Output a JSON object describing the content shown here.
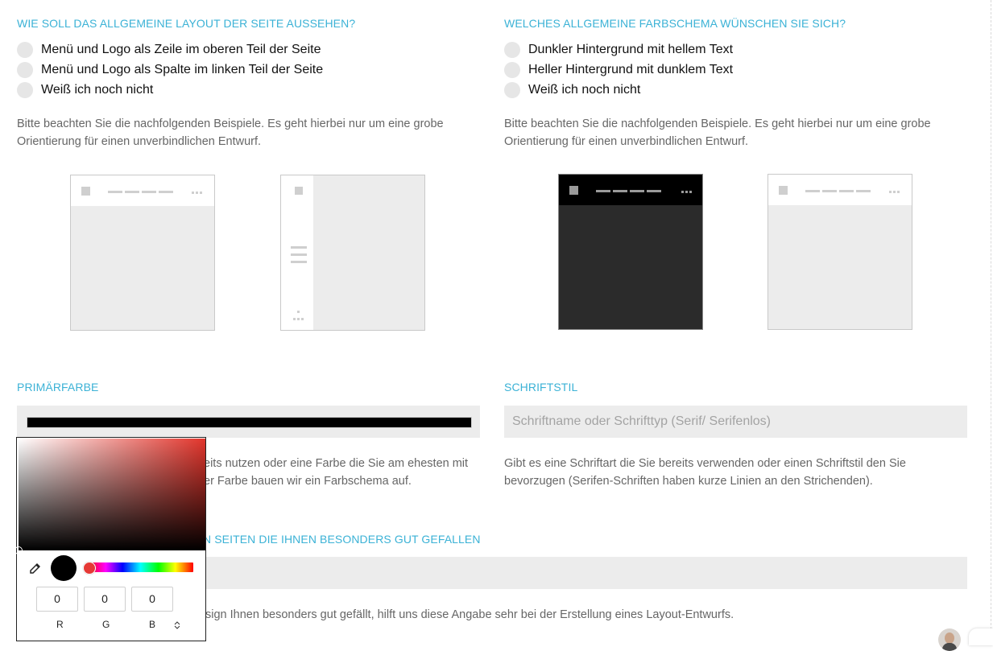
{
  "layout_question": {
    "title": "WIE SOLL DAS ALLGEMEINE LAYOUT DER SEITE AUSSEHEN?",
    "options": [
      "Menü und Logo als Zeile im oberen Teil der Seite",
      "Menü und Logo als Spalte im linken Teil der Seite",
      "Weiß ich noch nicht"
    ],
    "hint_line1": "Bitte beachten Sie die nachfolgenden Beispiele. Es geht hierbei nur um eine grobe",
    "hint_line2": "Orientierung für einen unverbindlichen Entwurf."
  },
  "color_question": {
    "title": "WELCHES ALLGEMEINE FARBSCHEMA WÜNSCHEN SIE SICH?",
    "options": [
      "Dunkler Hintergrund mit hellem Text",
      "Heller Hintergrund mit dunklem Text",
      "Weiß ich noch nicht"
    ],
    "hint_line1": "Bitte beachten Sie die nachfolgenden Beispiele. Es geht hierbei nur um eine grobe",
    "hint_line2": "Orientierung für einen unverbindlichen Entwurf."
  },
  "primary_color": {
    "title": "PRIMÄRFARBE",
    "value_color": "#000000",
    "hint_line1": "eits nutzen oder eine Farbe die Sie am ehesten mit",
    "hint_line2": "er Farbe bauen wir ein Farbschema auf."
  },
  "font_style": {
    "title": "SCHRIFTSTIL",
    "placeholder": "Schriftname oder Schrifttyp (Serif/ Serifenlos)",
    "hint_line1": "Gibt es eine Schriftart die Sie bereits verwenden oder einen Schriftstil den Sie",
    "hint_line2": "bevorzugen (Serifen-Schriften haben kurze Linien an den Strichenden)."
  },
  "favorites": {
    "title": "N SEITEN DIE IHNEN BESONDERS GUT GEFALLEN",
    "hint": "sign Ihnen besonders gut gefällt, hilft uns diese Angabe sehr bei der Erstellung eines Layout-Entwurfs."
  },
  "color_picker": {
    "r": "0",
    "g": "0",
    "b": "0",
    "label_r": "R",
    "label_g": "G",
    "label_b": "B",
    "mode_toggle": "⌃⌄",
    "hue_color": "#e2352c"
  },
  "icons": [
    "eyedropper-icon",
    "avatar"
  ],
  "colors": {
    "accent": "#3bb2d6",
    "field_bg": "#ececec"
  }
}
